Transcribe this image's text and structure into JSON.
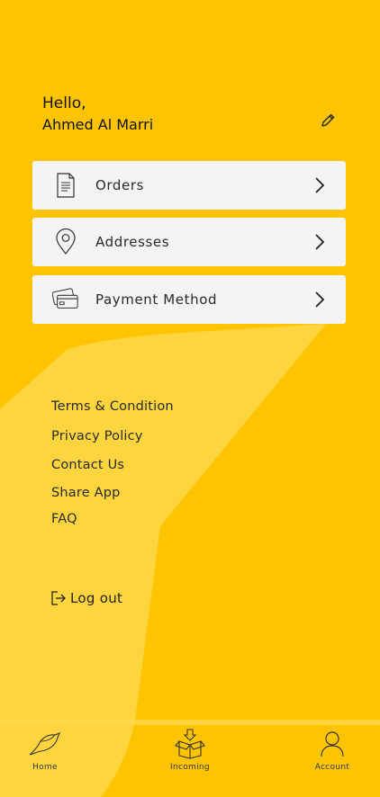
{
  "greeting": {
    "hello": "Hello,",
    "name": "Ahmed Al Marri"
  },
  "menu": [
    {
      "label": "Orders",
      "icon": "document-icon"
    },
    {
      "label": "Addresses",
      "icon": "location-pin-icon"
    },
    {
      "label": "Payment Method",
      "icon": "credit-card-icon"
    }
  ],
  "links": [
    "Terms & Condition",
    "Privacy Policy",
    "Contact Us",
    "Share App",
    "FAQ"
  ],
  "logout": {
    "label": "Log out",
    "icon": "logout-icon"
  },
  "bottom_nav": [
    {
      "label": "Home",
      "icon": "bird-icon"
    },
    {
      "label": "Incoming",
      "icon": "box-download-icon"
    },
    {
      "label": "Account",
      "icon": "user-icon"
    }
  ],
  "colors": {
    "background": "#FFC400",
    "highlight": "#FFD84A",
    "card": "#F4F4F4"
  }
}
